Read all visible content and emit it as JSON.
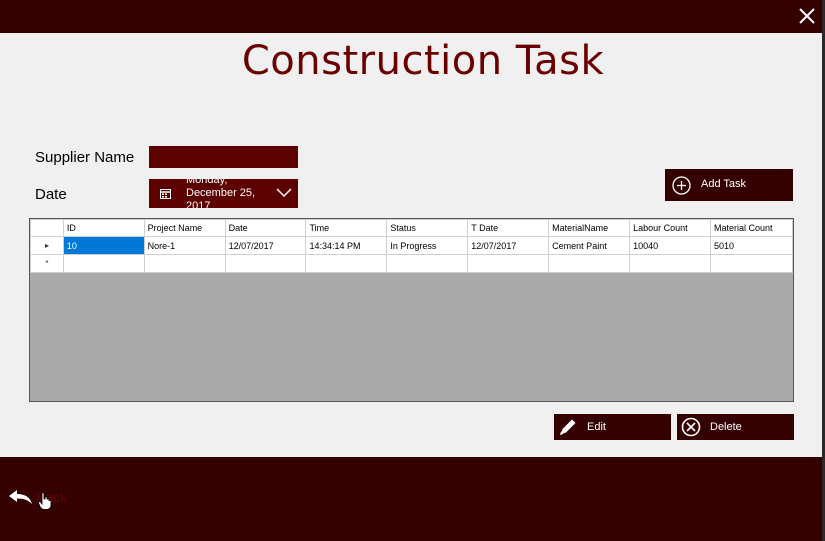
{
  "window": {
    "close_icon": "close-icon"
  },
  "header": {
    "title": "Construction Task"
  },
  "form": {
    "supplier_label": "Supplier Name",
    "supplier_value": "",
    "date_label": "Date",
    "date_value": "Monday, December 25, 2017"
  },
  "buttons": {
    "add_task": "Add Task",
    "edit": "Edit",
    "delete": "Delete"
  },
  "grid": {
    "columns": [
      "ID",
      "Project Name",
      "Date",
      "Time",
      "Status",
      "T Date",
      "MaterialName",
      "Labour Count",
      "Material Count"
    ],
    "rows": [
      [
        "10",
        "Nore-1",
        "12/07/2017",
        "14:34:14 PM",
        "In Progress",
        "12/07/2017",
        "Cement  Paint",
        "10040",
        "5010"
      ]
    ],
    "new_row_marker": "*",
    "current_row_marker": "▸"
  },
  "footer": {
    "back_label": "Back"
  },
  "colors": {
    "dark": "#340000",
    "accent": "#5c0000",
    "title": "#6b0000",
    "selection": "#0078d7"
  }
}
